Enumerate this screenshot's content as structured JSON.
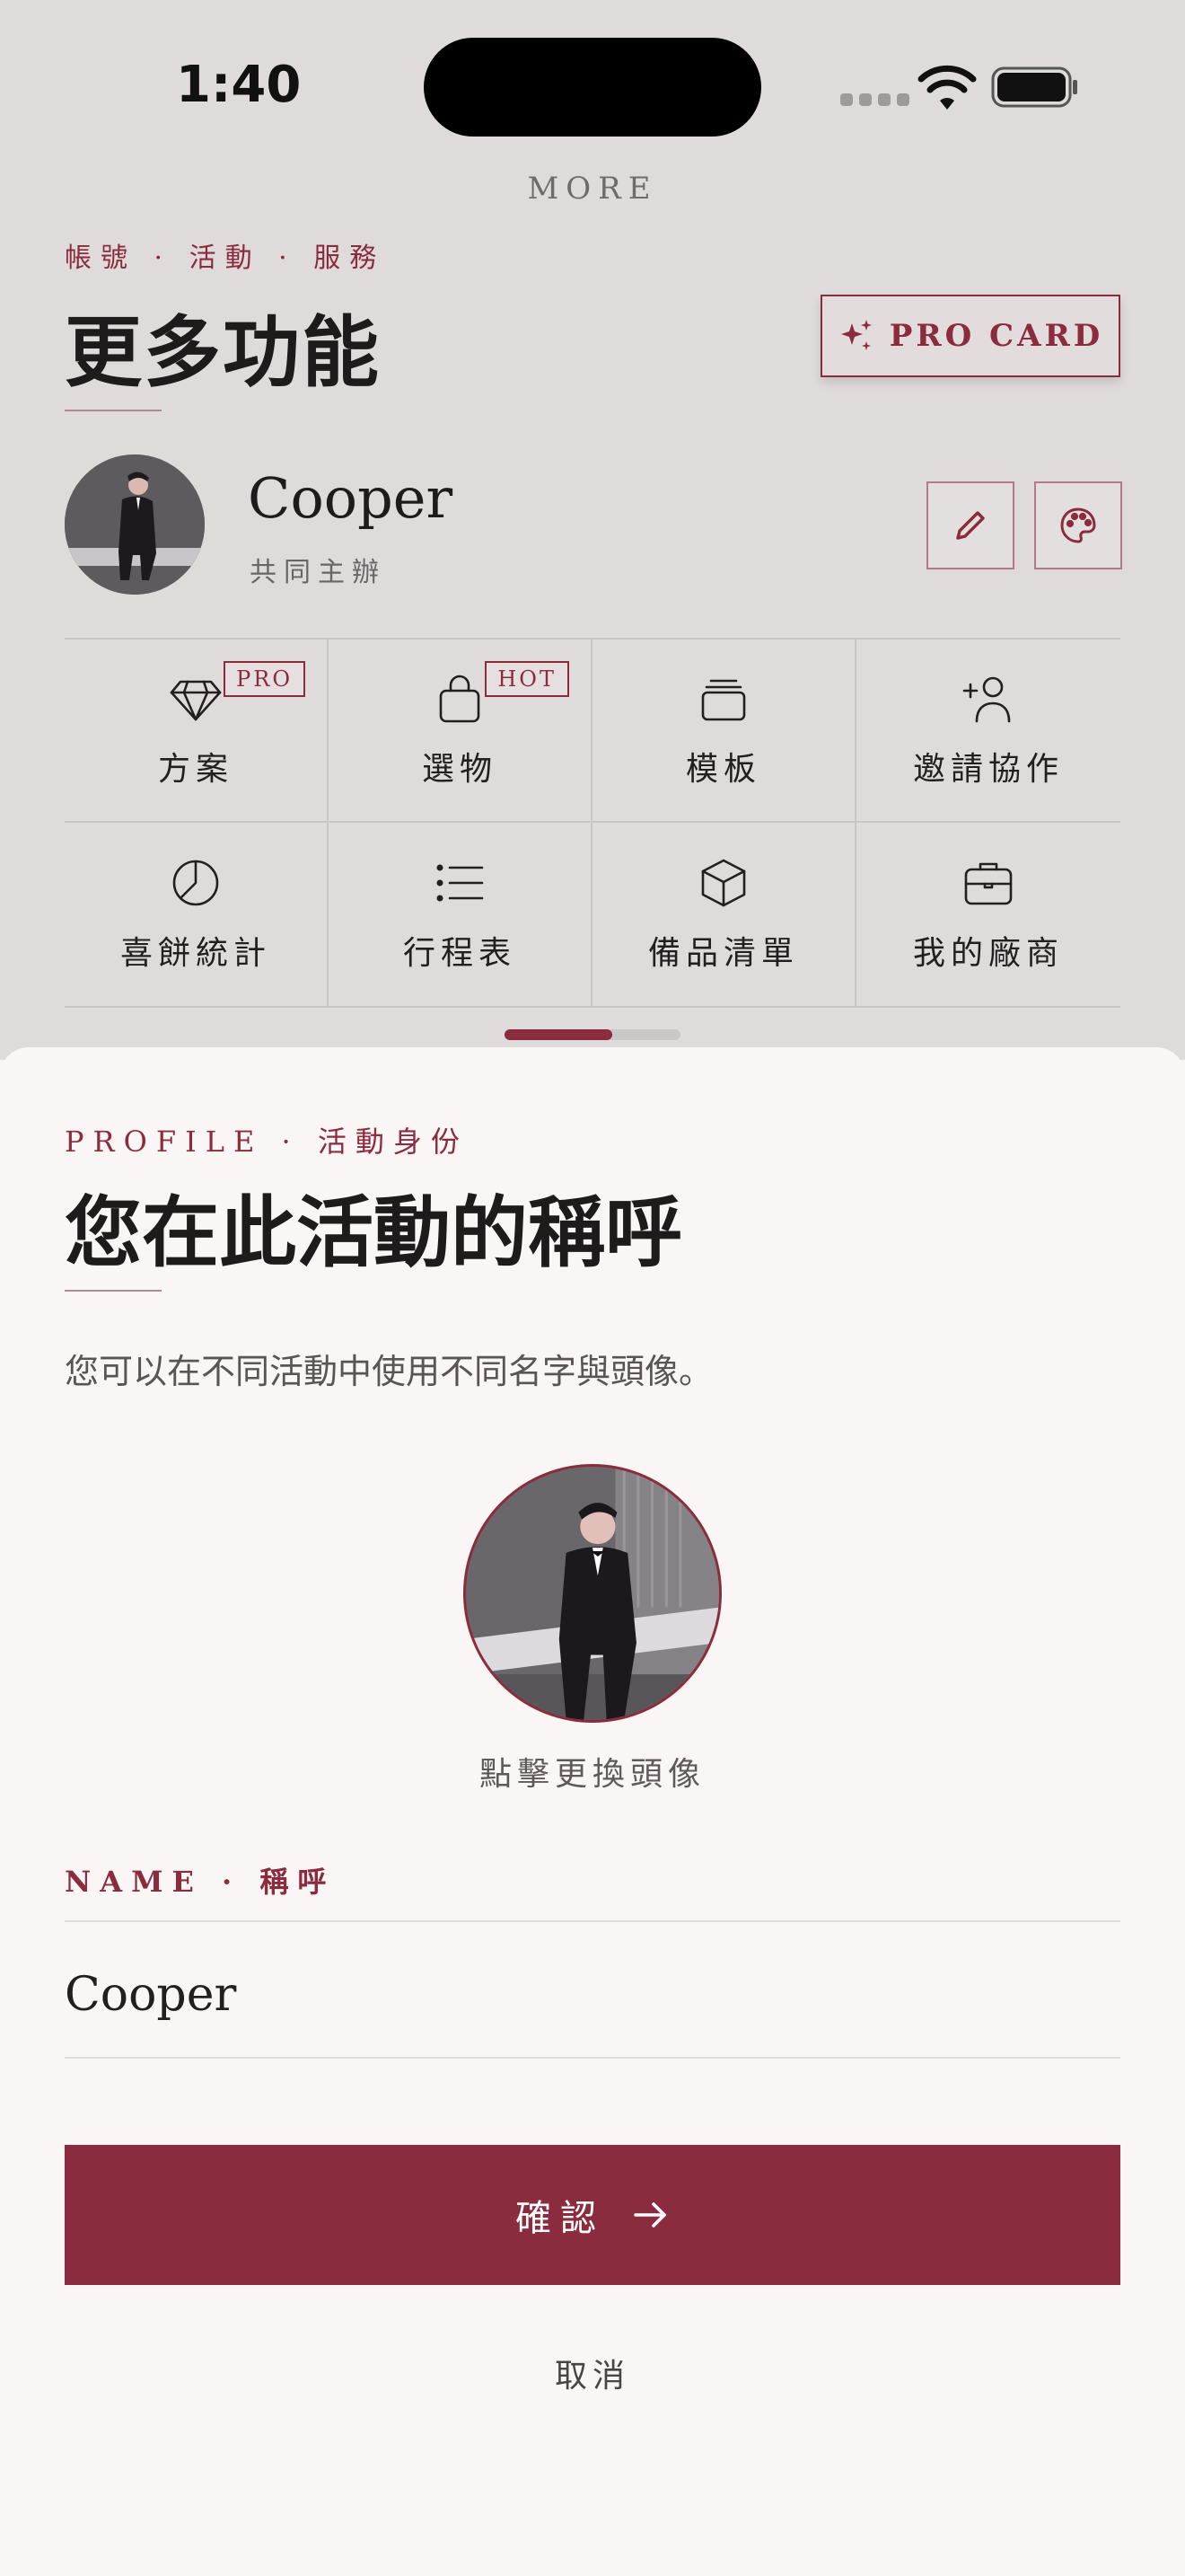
{
  "status_bar": {
    "time": "1:40"
  },
  "header": {
    "section_label": "MORE",
    "eyebrow": "帳號 · 活動 · 服務",
    "title": "更多功能",
    "pro_card_label": "PRO CARD"
  },
  "profile": {
    "name": "Cooper",
    "role": "共同主辦",
    "edit_icon": "pencil-icon",
    "theme_icon": "palette-icon"
  },
  "features": [
    {
      "label": "方案",
      "icon": "diamond-icon",
      "badge": "PRO"
    },
    {
      "label": "選物",
      "icon": "shopping-bag-icon",
      "badge": "HOT"
    },
    {
      "label": "模板",
      "icon": "stack-icon",
      "badge": ""
    },
    {
      "label": "邀請協作",
      "icon": "user-plus-icon",
      "badge": ""
    },
    {
      "label": "喜餅統計",
      "icon": "pie-chart-icon",
      "badge": ""
    },
    {
      "label": "行程表",
      "icon": "list-icon",
      "badge": ""
    },
    {
      "label": "備品清單",
      "icon": "box-icon",
      "badge": ""
    },
    {
      "label": "我的廠商",
      "icon": "briefcase-icon",
      "badge": ""
    }
  ],
  "pager": {
    "progress": 0.61
  },
  "sheet": {
    "eyebrow": "PROFILE · 活動身份",
    "title": "您在此活動的稱呼",
    "description": "您可以在不同活動中使用不同名字與頭像。",
    "avatar_hint": "點擊更換頭像",
    "name_label": "NAME · 稱呼",
    "name_value": "Cooper",
    "confirm_label": "確認",
    "cancel_label": "取消"
  },
  "colors": {
    "accent": "#8b2c3e",
    "background_top": "#dfdbdb",
    "sheet_background": "#faf6f5"
  }
}
